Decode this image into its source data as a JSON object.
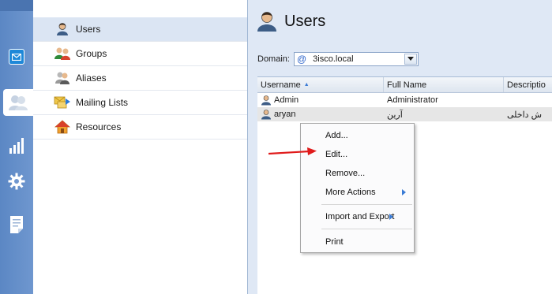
{
  "navigation": {
    "items": [
      {
        "label": "Users",
        "icon": "user-icon",
        "selected": true
      },
      {
        "label": "Groups",
        "icon": "groups-icon",
        "selected": false
      },
      {
        "label": "Aliases",
        "icon": "aliases-icon",
        "selected": false
      },
      {
        "label": "Mailing Lists",
        "icon": "mailing-list-icon",
        "selected": false
      },
      {
        "label": "Resources",
        "icon": "resources-home-icon",
        "selected": false
      }
    ]
  },
  "rail": {
    "icons": [
      "mail-icon",
      "accounts-icon",
      "statistics-icon",
      "settings-gear-icon",
      "logs-icon"
    ]
  },
  "main": {
    "title": "Users",
    "domain_label": "Domain:",
    "domain_symbol": "@",
    "domain_value": "3isco.local"
  },
  "grid": {
    "columns": [
      "Username",
      "Full Name",
      "Descriptio"
    ],
    "sort_indicator": "▲",
    "rows": [
      {
        "username": "Admin",
        "full_name": "Administrator",
        "description": ""
      },
      {
        "username": "aryan",
        "full_name": "آرین",
        "description": "ش داخلی"
      }
    ]
  },
  "context_menu": {
    "items": {
      "add": "Add...",
      "edit": "Edit...",
      "remove": "Remove...",
      "more_actions": "More Actions",
      "import_export": "Import and Export",
      "print": "Print"
    }
  },
  "colors": {
    "rail": "#6f97cf",
    "selection": "#dbe5f3",
    "panel_bg": "#dfe8f5",
    "arrow": "#e01b1b",
    "submenu_arrow": "#3a7bd5"
  }
}
